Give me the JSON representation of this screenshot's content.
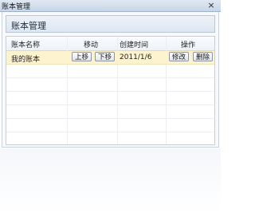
{
  "window": {
    "title": "账本管理",
    "close_glyph": "×"
  },
  "panel": {
    "title": "账本管理"
  },
  "table": {
    "headers": {
      "name": "账本名称",
      "move": "移动",
      "created": "创建时间",
      "actions": "操作"
    },
    "rows": [
      {
        "name": "我的账本",
        "up": "上移",
        "down": "下移",
        "created": "2011/1/6",
        "edit": "修改",
        "delete": "删除"
      }
    ]
  },
  "colors": {
    "selected_row": "#fdf3cf",
    "titlebar": "#c9d6e6"
  }
}
